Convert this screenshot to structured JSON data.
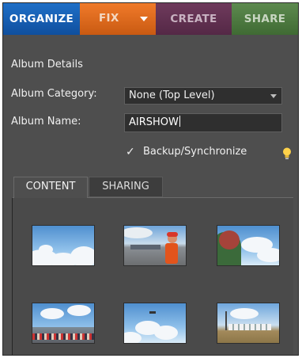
{
  "workspace_tabs": {
    "organize": "ORGANIZE",
    "fix": "FIX",
    "create": "CREATE",
    "share": "SHARE"
  },
  "album": {
    "section_title": "Album Details",
    "category_label": "Album Category:",
    "category_value": "None (Top Level)",
    "name_label": "Album Name:",
    "name_value": "AIRSHOW",
    "backup_label": "Backup/Synchronize",
    "backup_checked": true
  },
  "content_tabs": {
    "content": "CONTENT",
    "sharing": "SHARING"
  },
  "thumbnails": [
    {
      "subject": "sky-clouds"
    },
    {
      "subject": "person-airfield"
    },
    {
      "subject": "child-sky"
    },
    {
      "subject": "crowd-airshow"
    },
    {
      "subject": "sky-clouds"
    },
    {
      "subject": "aircraft-lineup"
    }
  ],
  "colors": {
    "organize": "#1a64b8",
    "fix": "#e2701f",
    "create": "#5e2f50",
    "share": "#4a7a3f",
    "panel": "#4e4e4e"
  },
  "icons": [
    "dropdown-arrow",
    "chevron-down-icon",
    "checkmark-icon",
    "lightbulb-icon"
  ]
}
